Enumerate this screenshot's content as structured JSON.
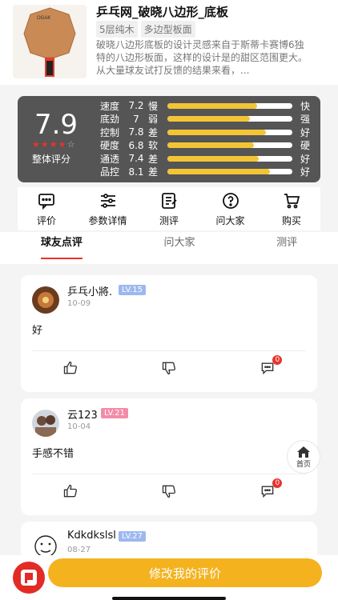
{
  "product": {
    "title": "乒乓网_破晓八边形_底板",
    "tags": [
      "5层纯木",
      "多边型板面"
    ],
    "description": "破晓八边形底板的设计灵感来自于斯蒂卡赛博6独特的八边形板面，这样的设计是的甜区范围更大。从大量球友试打反馈的结果来看，..."
  },
  "score": {
    "value": "7.9",
    "stars_on": 4,
    "stars_total": 5,
    "caption": "整体评分",
    "metrics": [
      {
        "name": "速度",
        "value": "7.2",
        "word": "慢",
        "end": "快",
        "level": 0.72
      },
      {
        "name": "底劲",
        "value": "7",
        "word": "弱",
        "end": "强",
        "level": 0.66
      },
      {
        "name": "控制",
        "value": "7.8",
        "word": "差",
        "end": "好",
        "level": 0.79
      },
      {
        "name": "硬度",
        "value": "6.8",
        "word": "软",
        "end": "硬",
        "level": 0.69
      },
      {
        "name": "通透",
        "value": "7.4",
        "word": "差",
        "end": "好",
        "level": 0.73
      },
      {
        "name": "品控",
        "value": "8.1",
        "word": "差",
        "end": "好",
        "level": 0.82
      }
    ]
  },
  "actions": [
    {
      "label": "评价",
      "icon": "comment-icon"
    },
    {
      "label": "参数详情",
      "icon": "sliders-icon"
    },
    {
      "label": "测评",
      "icon": "review-icon"
    },
    {
      "label": "问大家",
      "icon": "question-icon"
    },
    {
      "label": "购买",
      "icon": "cart-icon"
    }
  ],
  "tabs": [
    {
      "label": "球友点评",
      "active": true
    },
    {
      "label": "问大家",
      "active": false
    },
    {
      "label": "测评",
      "active": false
    }
  ],
  "comments": [
    {
      "user": "乒乓小將.",
      "level": "LV.15",
      "level_color": "#9db8ef",
      "date": "10-09",
      "text": "好",
      "badge": "0"
    },
    {
      "user": "云123",
      "level": "LV.21",
      "level_color": "#f28ca8",
      "date": "10-04",
      "text": "手感不错",
      "badge": "0"
    },
    {
      "user": "Kdkdkslsl",
      "level": "LV.27",
      "level_color": "#9db8ef",
      "date": "08-27",
      "text": "",
      "badge": ""
    }
  ],
  "home_float": {
    "label": "首页"
  },
  "cta": {
    "label": "修改我的评价"
  },
  "colors": {
    "accent": "#e8332c",
    "cta": "#f4b21e",
    "bar": "#f3c536"
  }
}
